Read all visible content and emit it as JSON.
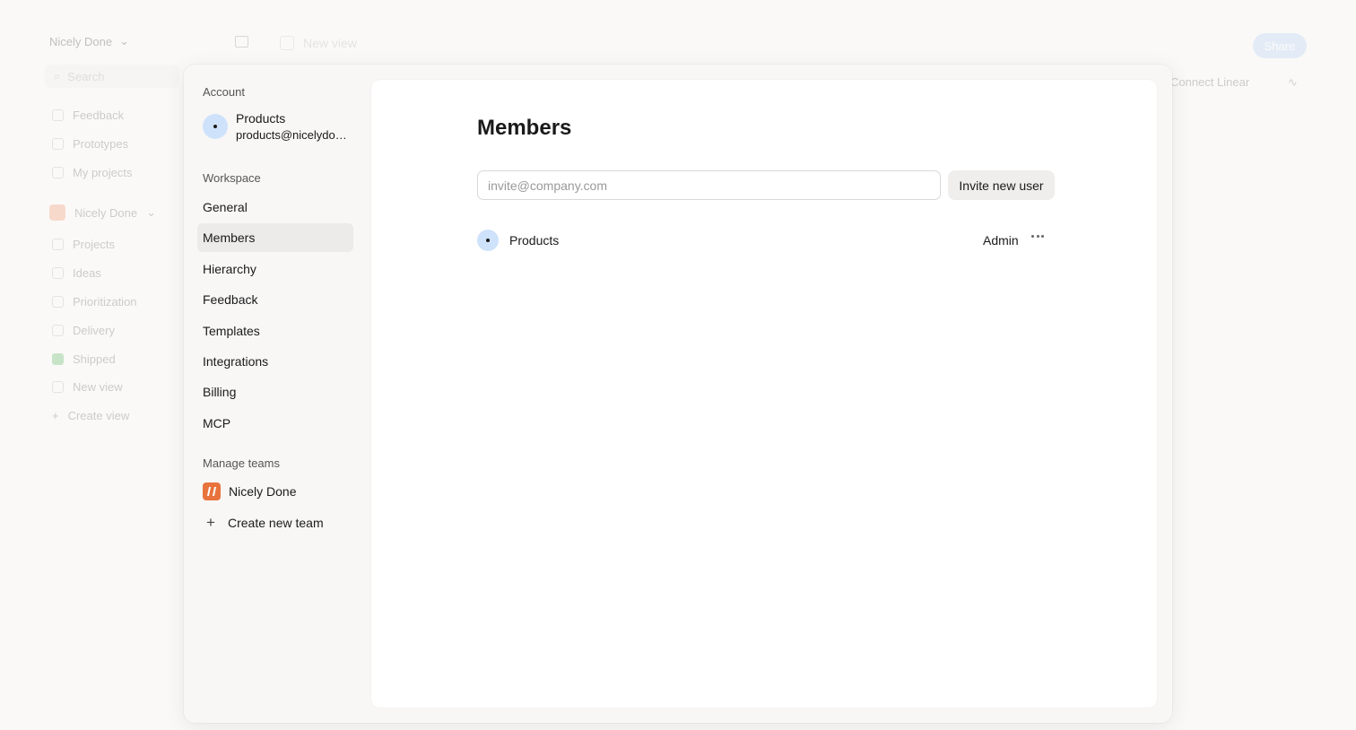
{
  "background": {
    "workspace_name": "Nicely Done",
    "search_placeholder": "Search",
    "nav_items": [
      "Feedback",
      "Prototypes",
      "My projects"
    ],
    "team_name": "Nicely Done",
    "team_items": [
      "Projects",
      "Ideas",
      "Prioritization",
      "Delivery",
      "Shipped",
      "New view",
      "Create view"
    ],
    "view_title": "New view",
    "share_label": "Share",
    "connect_label": "Connect Linear"
  },
  "settings_nav": {
    "account_heading": "Account",
    "account": {
      "name": "Products",
      "email": "products@nicelydone.club"
    },
    "workspace_heading": "Workspace",
    "workspace_items": [
      "General",
      "Members",
      "Hierarchy",
      "Feedback",
      "Templates",
      "Integrations",
      "Billing",
      "MCP"
    ],
    "active_item": "Members",
    "teams_heading": "Manage teams",
    "team_name": "Nicely Done",
    "create_team_label": "Create new team"
  },
  "members_page": {
    "title": "Members",
    "invite_placeholder": "invite@company.com",
    "invite_button": "Invite new user",
    "members": [
      {
        "name": "Products",
        "role": "Admin"
      }
    ]
  },
  "colors": {
    "avatar_bg": "#cfe2fb",
    "team_logo": "#e8733d",
    "active_nav_bg": "#ecebe9",
    "share_button": "#b9d3f3"
  }
}
